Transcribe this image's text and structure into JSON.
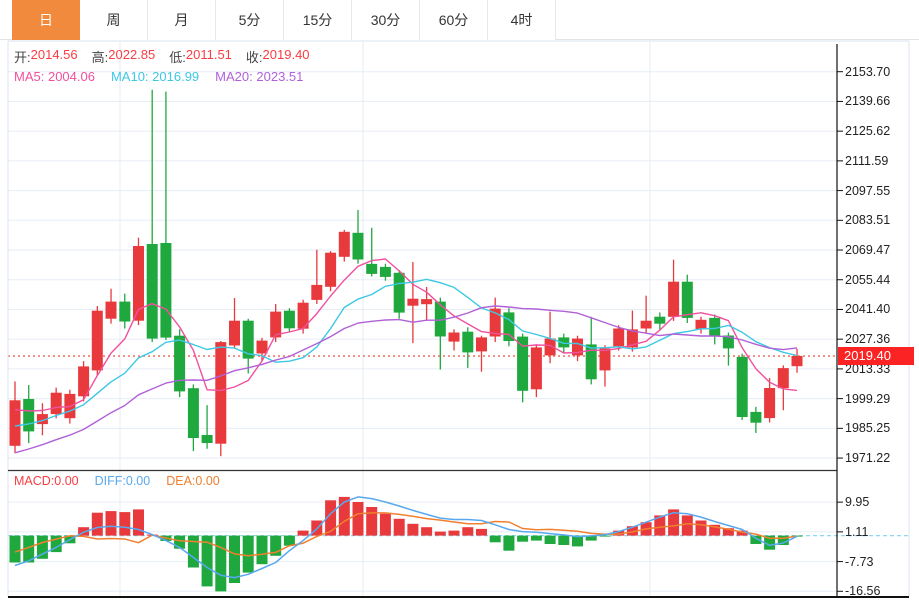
{
  "tabs": {
    "items": [
      {
        "label": "日",
        "slug": "day",
        "active": true
      },
      {
        "label": "周",
        "slug": "week",
        "active": false
      },
      {
        "label": "月",
        "slug": "month",
        "active": false
      },
      {
        "label": "5分",
        "slug": "5min",
        "active": false
      },
      {
        "label": "15分",
        "slug": "15min",
        "active": false
      },
      {
        "label": "30分",
        "slug": "30min",
        "active": false
      },
      {
        "label": "60分",
        "slug": "60min",
        "active": false
      },
      {
        "label": "4时",
        "slug": "4hour",
        "active": false
      }
    ]
  },
  "info": {
    "open_label": "开:",
    "open": "2014.56",
    "high_label": "高:",
    "high": "2022.85",
    "low_label": "低:",
    "low": "2011.51",
    "close_label": "收:",
    "close": "2019.40",
    "ma5_label": "MA5:",
    "ma5": "2004.06",
    "ma10_label": "MA10:",
    "ma10": "2016.99",
    "ma20_label": "MA20:",
    "ma20": "2023.51"
  },
  "macd_info": {
    "macd_label": "MACD:",
    "macd": "0.00",
    "diff_label": "DIFF:",
    "diff": "0.00",
    "dea_label": "DEA:",
    "dea": "0.00"
  },
  "price_tag": "2019.40",
  "colors": {
    "up": "#e8393d",
    "down": "#1fa83e",
    "ma5": "#f0519e",
    "ma10": "#3dc8e4",
    "ma20": "#b061d8",
    "diff_line": "#58a8f0",
    "dea_line": "#f08030",
    "tab_active_bg": "#f28a3d",
    "value_red": "#fa3d41",
    "ref_line": "#f4796a",
    "tag_bg": "#fb2323",
    "grid": "#e6edf5",
    "zero_dash": "#8fd8f2",
    "axis_line": "#111111",
    "border": "#d9e4ef"
  },
  "chart_data": {
    "type": "candlestick+macd",
    "title": "",
    "legend": [
      "MA5",
      "MA10",
      "MA20",
      "MACD",
      "DIFF",
      "DEA"
    ],
    "price_axis_ticks": [
      "2153.70",
      "2139.66",
      "2125.62",
      "2111.59",
      "2097.55",
      "2083.51",
      "2069.47",
      "2055.44",
      "2041.40",
      "2027.36",
      "2013.33",
      "1999.29",
      "1985.25",
      "1971.22"
    ],
    "price_axis_range": {
      "top": 2153.7,
      "bottom": 1971.22
    },
    "macd_axis_ticks": [
      "9.95",
      "1.11",
      "-7.73",
      "-16.56"
    ],
    "macd_axis_range": {
      "top": 9.95,
      "step": 8.84
    },
    "reference_price": 2019.4,
    "grid_x": [
      120,
      363,
      650
    ],
    "candles_ohlc": [
      [
        1977.0,
        2007.4,
        1973.6,
        1998.5
      ],
      [
        1999.1,
        2005.7,
        1978.3,
        1983.8
      ],
      [
        1987.3,
        1997.1,
        1982.0,
        1992.0
      ],
      [
        1992.0,
        2004.5,
        1990.0,
        2002.1
      ],
      [
        1990.0,
        2003.5,
        1987.5,
        2001.5
      ],
      [
        2000.4,
        2017.0,
        1998.0,
        2014.5
      ],
      [
        2012.6,
        2043.0,
        2010.0,
        2040.8
      ],
      [
        2037.0,
        2051.2,
        2034.7,
        2045.1
      ],
      [
        2045.1,
        2048.9,
        2032.4,
        2035.7
      ],
      [
        2036.1,
        2075.3,
        2034.0,
        2071.4
      ],
      [
        2072.3,
        2145.2,
        2026.0,
        2027.6
      ],
      [
        2072.8,
        2144.3,
        2027.0,
        2028.1
      ],
      [
        2029.0,
        2032.0,
        2000.0,
        2002.7
      ],
      [
        2004.2,
        2006.0,
        1974.5,
        1980.7
      ],
      [
        1982.1,
        1996.2,
        1975.6,
        1978.3
      ],
      [
        1978.0,
        2026.5,
        1972.1,
        2026.0
      ],
      [
        2024.4,
        2046.8,
        2023.0,
        2036.1
      ],
      [
        2036.1,
        2037.0,
        2011.2,
        2018.2
      ],
      [
        2020.6,
        2028.0,
        2017.0,
        2026.7
      ],
      [
        2028.2,
        2044.0,
        2026.0,
        2040.4
      ],
      [
        2040.8,
        2042.0,
        2030.9,
        2032.5
      ],
      [
        2032.3,
        2046.0,
        2030.0,
        2044.6
      ],
      [
        2045.9,
        2069.6,
        2044.0,
        2053.0
      ],
      [
        2052.1,
        2069.0,
        2050.0,
        2068.2
      ],
      [
        2066.3,
        2079.0,
        2064.0,
        2078.1
      ],
      [
        2077.6,
        2088.4,
        2063.0,
        2065.0
      ],
      [
        2062.9,
        2080.0,
        2057.0,
        2058.2
      ],
      [
        2061.5,
        2063.0,
        2055.0,
        2056.8
      ],
      [
        2058.7,
        2060.0,
        2037.0,
        2039.9
      ],
      [
        2043.2,
        2063.8,
        2025.5,
        2046.5
      ],
      [
        2043.9,
        2052.0,
        2036.0,
        2046.3
      ],
      [
        2045.1,
        2047.0,
        2013.0,
        2028.6
      ],
      [
        2026.2,
        2032.0,
        2022.0,
        2030.5
      ],
      [
        2030.9,
        2033.0,
        2013.8,
        2021.1
      ],
      [
        2021.6,
        2029.0,
        2012.0,
        2028.2
      ],
      [
        2028.6,
        2047.0,
        2026.0,
        2041.8
      ],
      [
        2040.0,
        2042.0,
        2024.0,
        2026.5
      ],
      [
        2028.6,
        2030.0,
        1997.5,
        2003.0
      ],
      [
        2003.7,
        2025.0,
        2000.0,
        2023.5
      ],
      [
        2019.7,
        2040.4,
        2016.0,
        2027.7
      ],
      [
        2028.2,
        2030.0,
        2021.0,
        2023.5
      ],
      [
        2019.7,
        2029.0,
        2017.0,
        2027.7
      ],
      [
        2024.9,
        2037.9,
        2006.0,
        2008.4
      ],
      [
        2012.6,
        2024.5,
        2005.0,
        2023.0
      ],
      [
        2024.0,
        2034.0,
        2022.0,
        2032.4
      ],
      [
        2023.5,
        2040.9,
        2021.5,
        2032.0
      ],
      [
        2032.4,
        2047.9,
        2030.0,
        2036.1
      ],
      [
        2038.0,
        2040.0,
        2032.0,
        2034.7
      ],
      [
        2037.9,
        2064.9,
        2036.0,
        2054.5
      ],
      [
        2054.5,
        2057.8,
        2035.0,
        2037.4
      ],
      [
        2032.0,
        2038.0,
        2030.0,
        2036.5
      ],
      [
        2037.4,
        2039.0,
        2024.9,
        2029.1
      ],
      [
        2029.1,
        2030.5,
        2014.9,
        2023.0
      ],
      [
        2019.0,
        2020.5,
        1989.2,
        1990.6
      ],
      [
        1993.0,
        1995.4,
        1983.1,
        1987.9
      ],
      [
        1990.1,
        2009.0,
        1988.0,
        2004.3
      ],
      [
        2004.2,
        2015.0,
        1993.8,
        2013.7
      ],
      [
        2014.56,
        2022.85,
        2011.51,
        2019.4
      ]
    ],
    "ma_warmup_closes": [
      1948,
      1952,
      1955,
      1958,
      1960,
      1963,
      1965,
      1968,
      1970,
      1972,
      1974,
      1976,
      1978,
      1981,
      1984,
      1987,
      1991,
      1995,
      1999
    ],
    "macd_histogram": [
      -8.0,
      -8.0,
      -6.9,
      -4.9,
      -2.3,
      2.5,
      6.8,
      7.3,
      7.0,
      7.8,
      0.3,
      -1.6,
      -3.9,
      -9.5,
      -15.1,
      -16.6,
      -14.1,
      -11.0,
      -8.5,
      -6.0,
      -3.0,
      1.5,
      4.5,
      10.5,
      11.5,
      10.0,
      8.5,
      6.5,
      5.0,
      3.5,
      2.5,
      1.2,
      1.5,
      2.5,
      2.0,
      -2.0,
      -4.5,
      -1.8,
      -1.5,
      -2.5,
      -2.8,
      -3.2,
      -1.5,
      -0.3,
      1.5,
      2.8,
      4.0,
      6.0,
      7.8,
      6.0,
      4.5,
      3.2,
      2.2,
      1.5,
      -2.5,
      -4.2,
      -2.8,
      -0.1
    ],
    "macd_diff": [
      -8.9,
      -7.5,
      -5.5,
      -3.5,
      -1.2,
      1.0,
      2.4,
      2.8,
      2.5,
      1.8,
      0.3,
      -1.5,
      -3.5,
      -6.5,
      -9.5,
      -11.8,
      -12.5,
      -11.5,
      -9.8,
      -8.0,
      -4.5,
      -1.5,
      2.0,
      6.5,
      10.0,
      11.5,
      11.0,
      10.0,
      8.8,
      7.5,
      6.3,
      5.2,
      4.8,
      4.8,
      4.5,
      3.2,
      1.8,
      1.2,
      1.0,
      0.6,
      0.2,
      -0.3,
      -0.1,
      0.3,
      1.2,
      2.5,
      4.0,
      5.5,
      6.8,
      6.5,
      5.5,
      4.2,
      3.0,
      1.8,
      -0.8,
      -2.9,
      -2.2,
      -0.2
    ]
  }
}
